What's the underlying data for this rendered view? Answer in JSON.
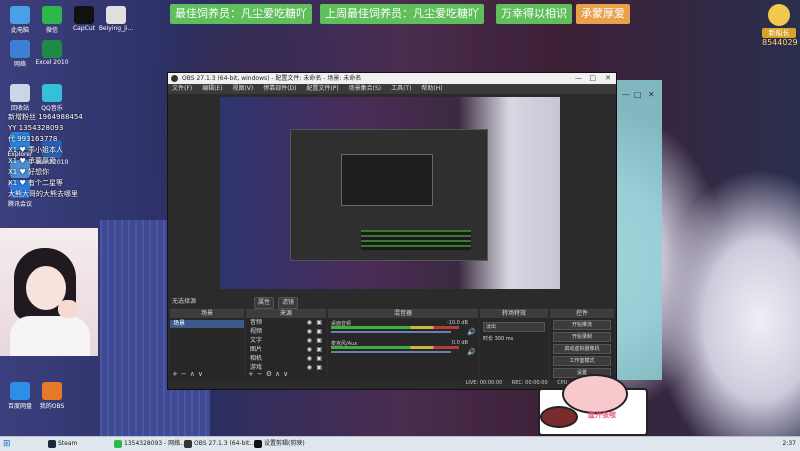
{
  "banners": [
    "最佳饲养员：凡尘爱吃糖吖",
    "上周最佳饲养员：凡尘爱吃糖吖",
    "万幸得以相识",
    "承蒙厚爱"
  ],
  "top_right": {
    "name": "新船长",
    "count": "8544029"
  },
  "desktop_icons": [
    {
      "label": "此电脑",
      "color": "#4aa0e6"
    },
    {
      "label": "微信",
      "color": "#2fb84a"
    },
    {
      "label": "CapCut",
      "color": "#111111"
    },
    {
      "label": "Beiying_ji...",
      "color": "#e0e0e0"
    },
    {
      "label": "网络",
      "color": "#3d7fd1"
    },
    {
      "label": "Excel 2010",
      "color": "#1f8a45"
    },
    {
      "label": "回收站",
      "color": "#c9d6e6"
    },
    {
      "label": "QQ音乐",
      "color": "#36c0d8"
    },
    {
      "label": "Word 2010",
      "color": "#2b5fb5"
    },
    {
      "label": "Explorer",
      "color": "#2a84d8"
    },
    {
      "label": "控制面板",
      "color": "#4e8fd6"
    },
    {
      "label": "腾讯会议",
      "color": "#2c7be5"
    },
    {
      "label": "百度网盘",
      "color": "#2e8de6"
    },
    {
      "label": "我的OBS",
      "color": "#e57a2a"
    }
  ],
  "overlay_lines": [
    "新增粉丝 1964988454",
    "YY 1354328093",
    "代 993163778",
    "X1 ♥ 乖小姐本人",
    "X1 ♥ 承蒙厚爱",
    "X1 ♥ 好想你",
    "X1 ♥ 有个二星等",
    "大熊大哥的大熊去哪里"
  ],
  "obs": {
    "title": "OBS 27.1.3 (64-bit, windows) - 配置文件: 未命名 - 场景: 未命名",
    "menu": [
      "文件(F)",
      "编辑(E)",
      "视图(V)",
      "停靠部件(D)",
      "配置文件(P)",
      "场景集合(S)",
      "工具(T)",
      "帮助(H)"
    ],
    "scene_status": "无选择源",
    "scene_buttons": [
      "属性",
      "滤镜"
    ],
    "docks": {
      "scenes": "场景",
      "sources": "来源",
      "mixer": "混音器",
      "transitions": "转场特效",
      "controls": "控件"
    },
    "scene_list": [
      "场景"
    ],
    "sources_list": [
      "音频",
      "视频",
      "文字",
      "图片",
      "相机",
      "游戏"
    ],
    "mixer": [
      {
        "label": "桌面音频",
        "db": "-10.0 dB"
      },
      {
        "label": "麦克风/Aux",
        "db": "0.0 dB"
      }
    ],
    "transition": {
      "value": "淡出",
      "duration_label": "时长",
      "duration": "300 ms"
    },
    "controls": [
      "开始推流",
      "开始录制",
      "启动虚拟摄像机",
      "工作室模式",
      "设置",
      "退出"
    ],
    "status": {
      "live": "LIVE: 00:00:00",
      "rec": "REC: 00:00:00",
      "cpu": "CPU: 1.3%, 30.00 fps"
    }
  },
  "taskbar": {
    "start": "⊞",
    "items": [
      {
        "label": "Steam",
        "color": "#1b2838"
      },
      {
        "label": "1354328093 - 网络...",
        "color": "#2fb84a"
      },
      {
        "label": "OBS 27.1.3 (64-bit...",
        "color": "#333333"
      },
      {
        "label": "设置剪辑(剪映)",
        "color": "#111111"
      }
    ],
    "tray": "2:37"
  },
  "sticker_text": "虚开张啦"
}
